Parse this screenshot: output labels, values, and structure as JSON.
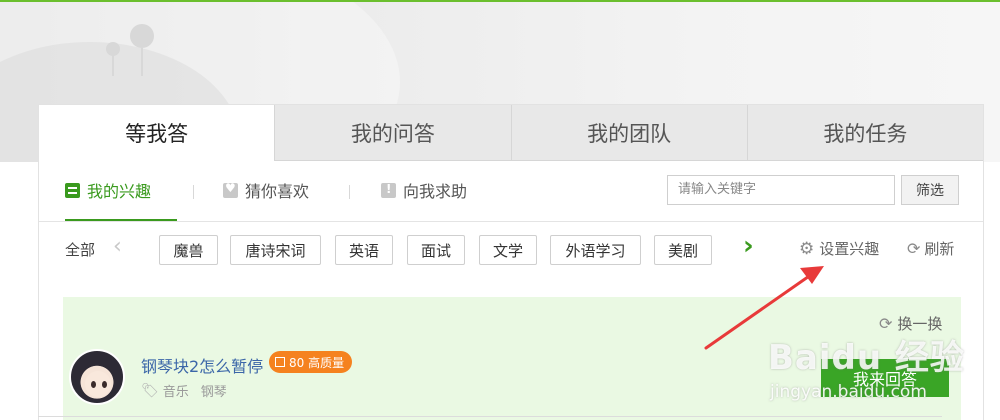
{
  "tabs": [
    {
      "label": "等我答",
      "active": true
    },
    {
      "label": "我的问答",
      "active": false
    },
    {
      "label": "我的团队",
      "active": false
    },
    {
      "label": "我的任务",
      "active": false
    }
  ],
  "subnav": {
    "items": [
      {
        "label": "我的兴趣",
        "icon": "list-icon",
        "active": true
      },
      {
        "label": "猜你喜欢",
        "icon": "heart-icon",
        "active": false
      },
      {
        "label": "向我求助",
        "icon": "exclamation-icon",
        "active": false
      }
    ],
    "search_placeholder": "请输入关键字",
    "filter_label": "筛选"
  },
  "tagbar": {
    "all_label": "全部",
    "tags": [
      "魔兽",
      "唐诗宋词",
      "英语",
      "面试",
      "文学",
      "外语学习",
      "美剧"
    ],
    "settings_label": "设置兴趣",
    "refresh_label": "刷新"
  },
  "question": {
    "swap_label": "换一换",
    "title": "钢琴块2怎么暂停",
    "badge": "80 高质量",
    "tags": [
      "音乐",
      "钢琴"
    ],
    "answer_label": "我来回答"
  },
  "watermark": {
    "logo": "Baidu 经验",
    "url": "jingyan.baidu.com"
  },
  "colors": {
    "accent_green": "#3a9a1e",
    "card_bg": "#eaf9e3",
    "badge_orange": "#f5821f",
    "annotation_red": "#e83a3a"
  }
}
